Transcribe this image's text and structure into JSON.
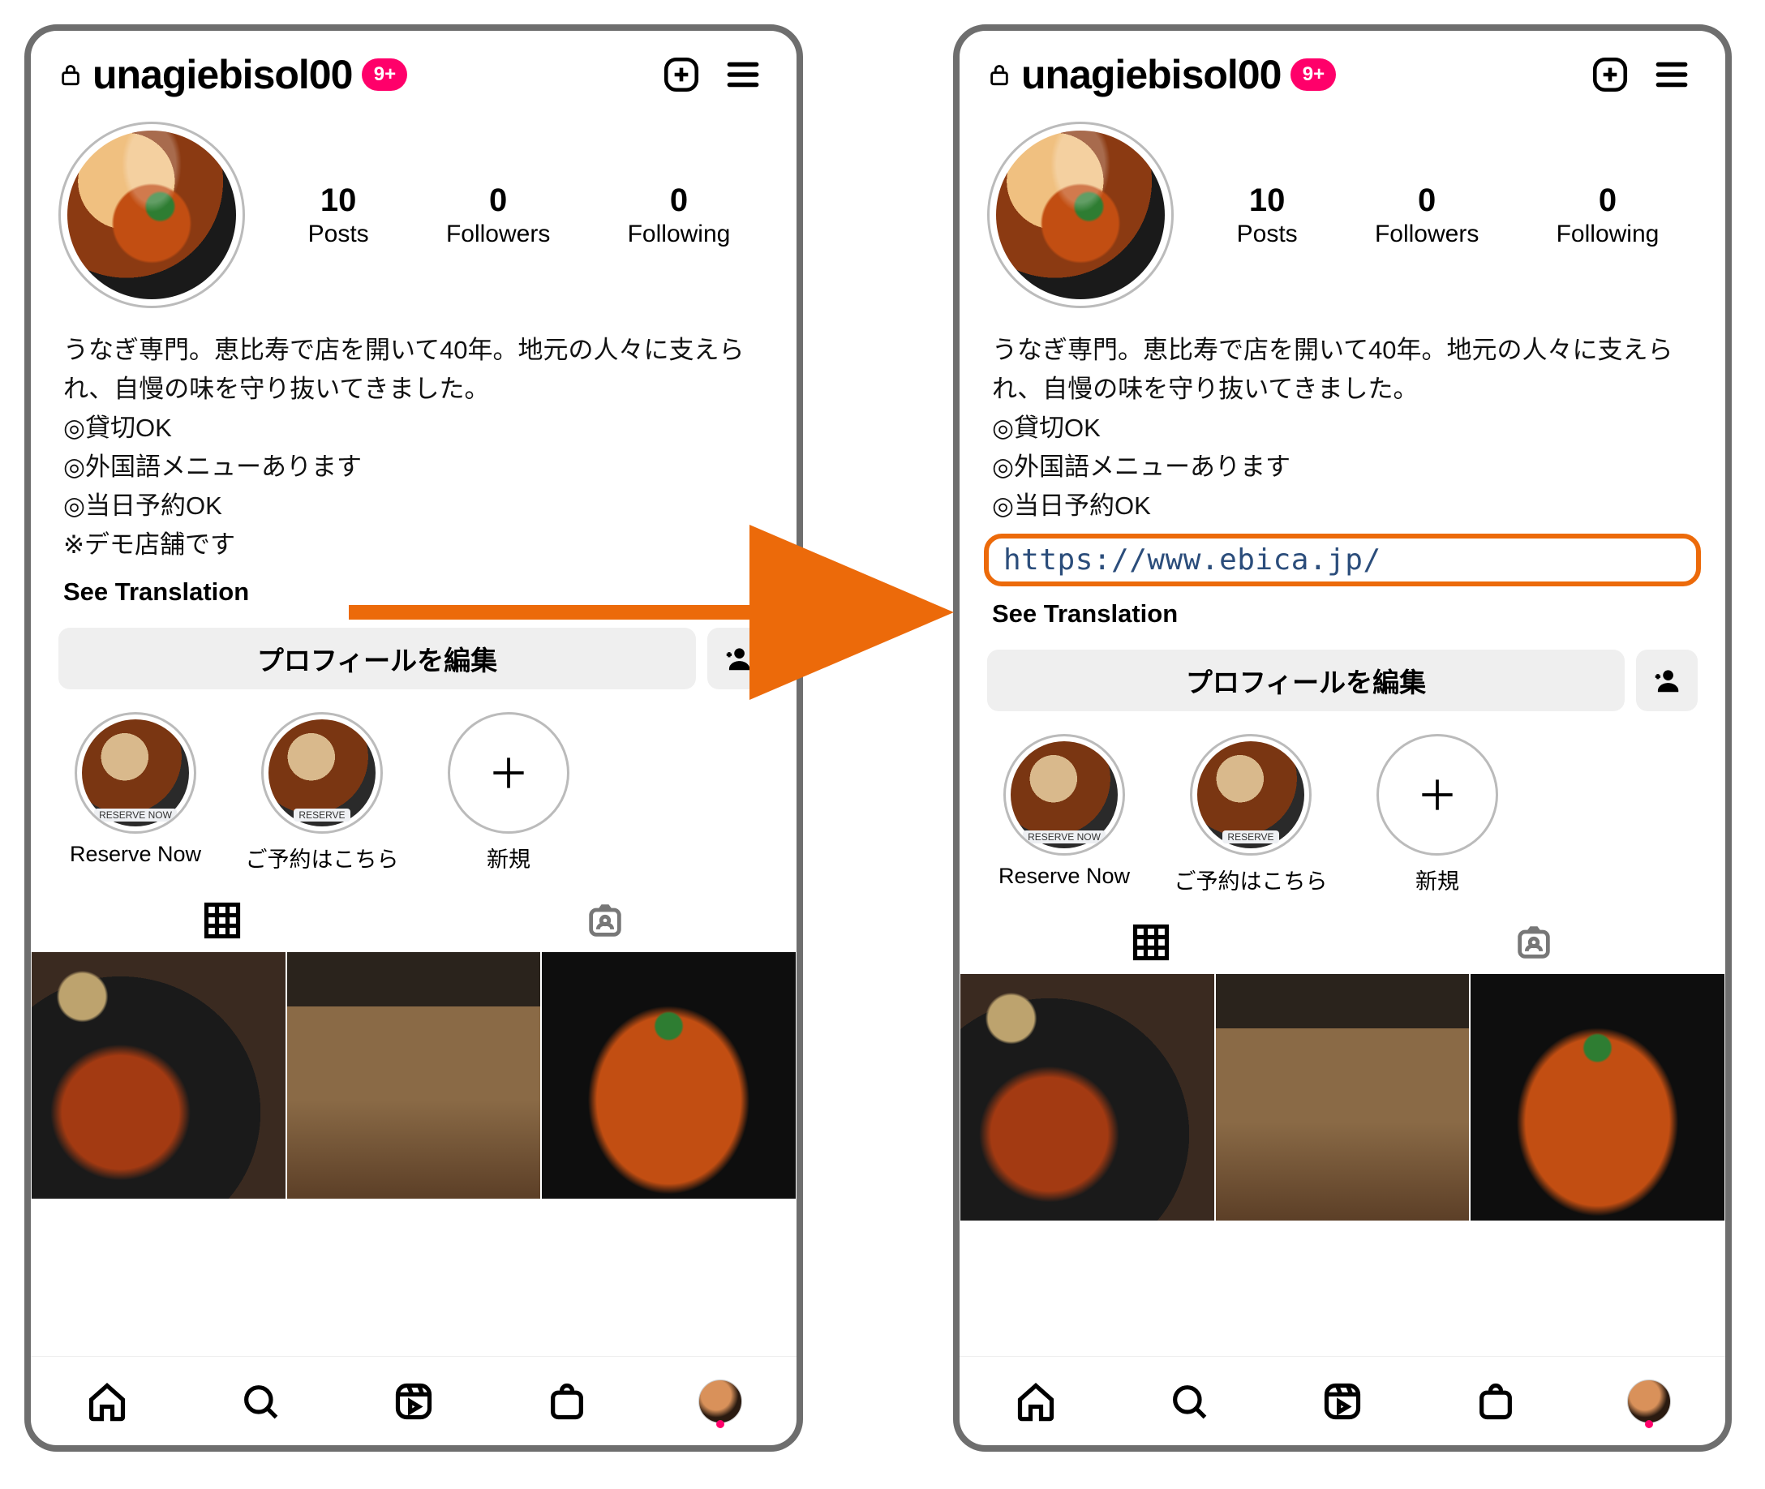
{
  "header": {
    "username": "unagiebisol00",
    "badge": "9+"
  },
  "stats": {
    "posts": {
      "num": "10",
      "label": "Posts"
    },
    "followers": {
      "num": "0",
      "label": "Followers"
    },
    "following": {
      "num": "0",
      "label": "Following"
    }
  },
  "bio_left": "うなぎ専門。恵比寿で店を開いて40年。地元の人々に支えられ、自慢の味を守り抜いてきました。\n◎貸切OK\n◎外国語メニューあります\n◎当日予約OK\n※デモ店舗です",
  "bio_right": "うなぎ専門。恵比寿で店を開いて40年。地元の人々に支えられ、自慢の味を守り抜いてきました。\n◎貸切OK\n◎外国語メニューあります\n◎当日予約OK",
  "bio_link": "https://www.ebica.jp/",
  "see_translation": "See Translation",
  "edit_profile": "プロフィールを編集",
  "highlights": [
    {
      "label": "Reserve Now",
      "tag": "RESERVE NOW"
    },
    {
      "label": "ご予約はこちら",
      "tag": "RESERVE"
    },
    {
      "label": "新規",
      "new": true
    }
  ]
}
